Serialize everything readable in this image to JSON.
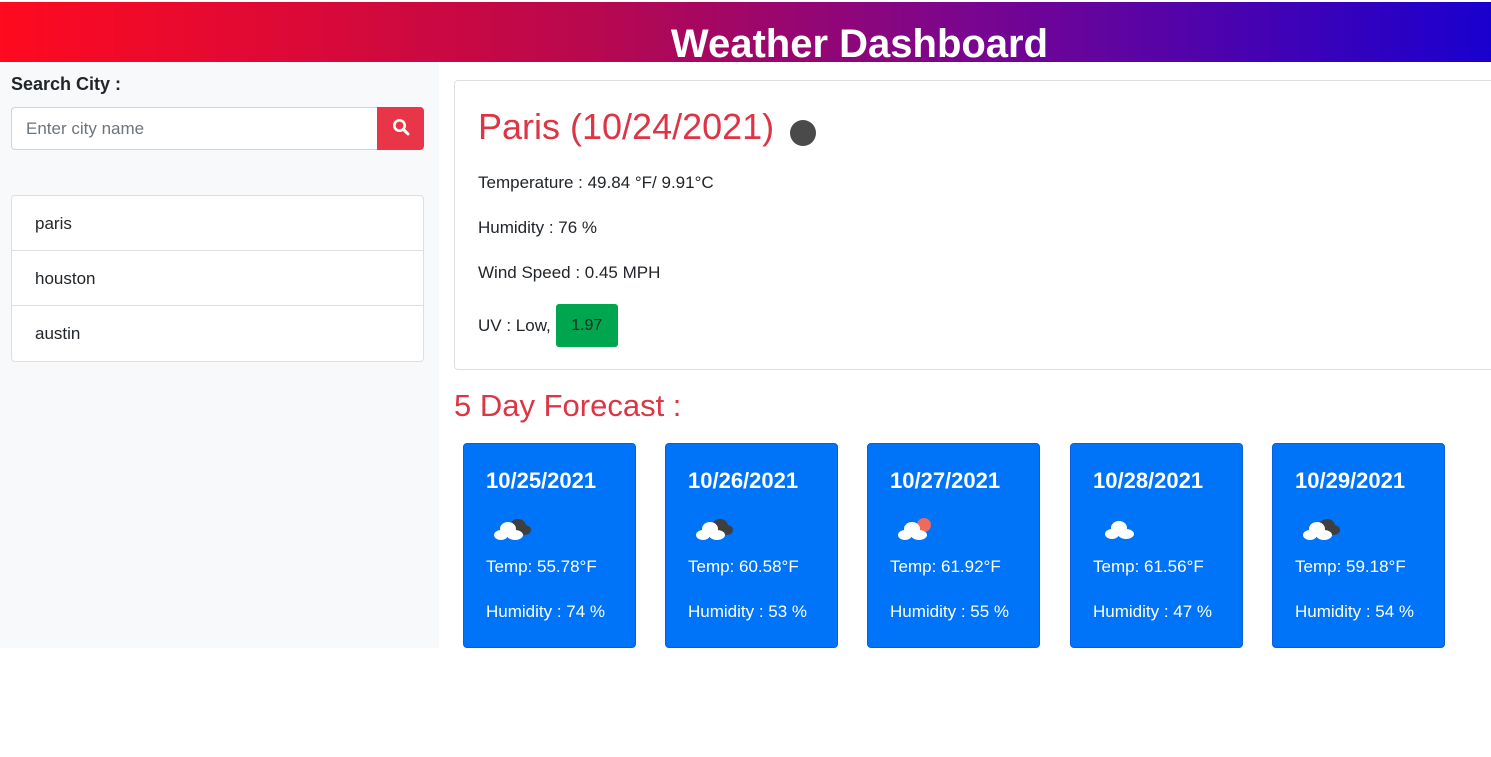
{
  "header": {
    "title": "Weather Dashboard"
  },
  "sidebar": {
    "search_label": "Search City :",
    "search_placeholder": "Enter city name",
    "search_value": "",
    "search_button_icon": "search-icon",
    "history": [
      {
        "label": "paris"
      },
      {
        "label": "houston"
      },
      {
        "label": "austin"
      }
    ]
  },
  "current": {
    "city_title": "Paris (10/24/2021)",
    "icon": "weather-icon",
    "temperature": "Temperature : 49.84 °F/ 9.91°C",
    "humidity": "Humidity : 76 %",
    "wind": "Wind Speed : 0.45 MPH",
    "uv_label": "UV : Low,",
    "uv_value": "1.97",
    "uv_color": "#00a54f"
  },
  "forecast": {
    "title": "5 Day Forecast :",
    "days": [
      {
        "date": "10/25/2021",
        "icon": "broken-clouds-icon",
        "temp": "Temp: 55.78°F",
        "humidity": "Humidity : 74 %"
      },
      {
        "date": "10/26/2021",
        "icon": "broken-clouds-icon",
        "temp": "Temp: 60.58°F",
        "humidity": "Humidity : 53 %"
      },
      {
        "date": "10/27/2021",
        "icon": "few-clouds-icon",
        "temp": "Temp: 61.92°F",
        "humidity": "Humidity : 55 %"
      },
      {
        "date": "10/28/2021",
        "icon": "scattered-clouds-icon",
        "temp": "Temp: 61.56°F",
        "humidity": "Humidity : 47 %"
      },
      {
        "date": "10/29/2021",
        "icon": "broken-clouds-icon",
        "temp": "Temp: 59.18°F",
        "humidity": "Humidity : 54 %"
      }
    ]
  },
  "colors": {
    "accent_red": "#dc3545",
    "search_button": "#e83547",
    "forecast_card": "#0074f8",
    "sidebar_bg": "#f8f9fa"
  }
}
